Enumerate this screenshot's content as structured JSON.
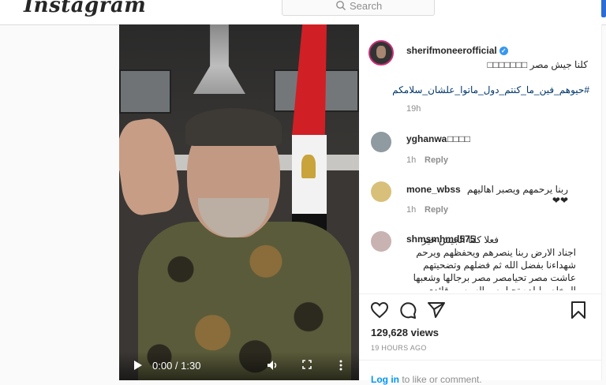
{
  "header": {
    "logo": "Instagram",
    "search_placeholder": "Search"
  },
  "video": {
    "time": "0:00 / 1:30"
  },
  "post": {
    "author": "sherifmoneerofficial",
    "caption": "كلنا جيش مصر □□□□□□□",
    "hashtag": "#حيوهم_فين_ما_كنتم_دول_ماتوا_علشان_سلامكم",
    "time": "19h"
  },
  "comments": [
    {
      "user": "yghanwa",
      "text": "□□□□",
      "time": "1h",
      "reply": "Reply"
    },
    {
      "user": "mone_wbss",
      "text": "ربنا يرحمهم ويصبر اهاليهم ❤❤",
      "time": "1h",
      "reply": "Reply"
    },
    {
      "user": "shmsmhmd575",
      "text": "فعلا كلنا الجيش خير اجناد الارض ربنا ينصرهم ويحفظهم ويرحم شهداءنا بفضل الله ثم فضلهم وتضحيتهم عاشت مصر تحيامصر مصر برجالها وشعبها المخلص لبلده تحيامصر السيسي قائدي والعالم كله"
    }
  ],
  "stats": {
    "views": "129,628 views",
    "ago": "19 HOURS AGO"
  },
  "footer": {
    "login": "Log in",
    "login_suffix": " to like or comment."
  }
}
